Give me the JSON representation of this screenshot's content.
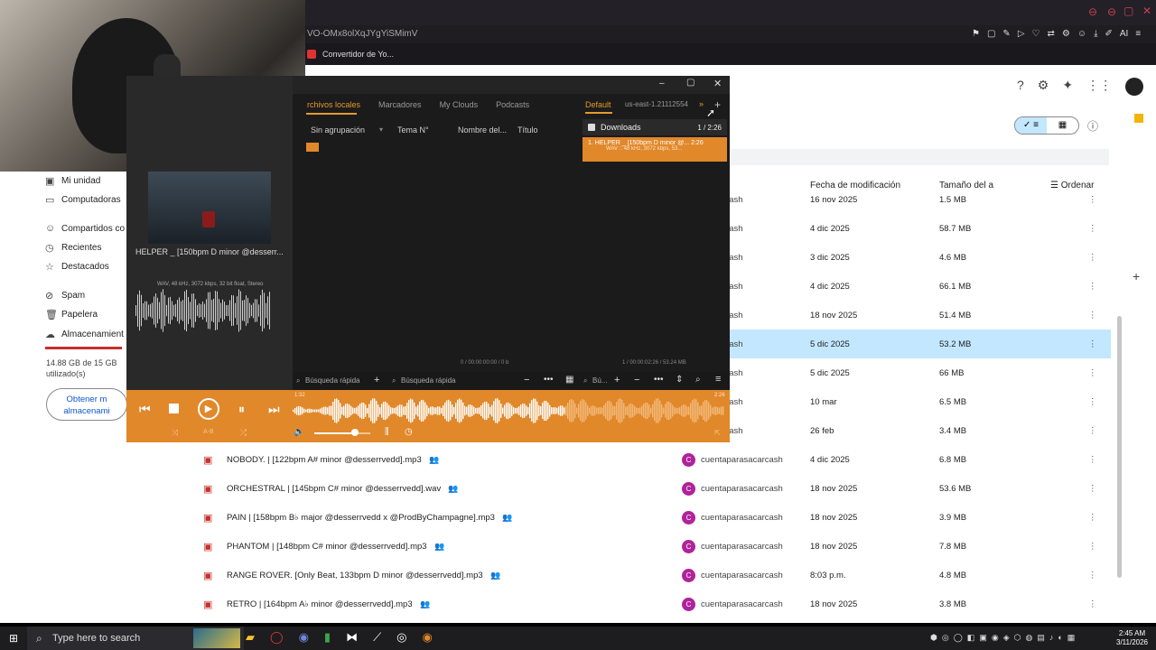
{
  "browser": {
    "address": "VO-OMx8olXqJYgYiSMimV",
    "bookmark": "Convertidor de Yo..."
  },
  "drive": {
    "sidebar": [
      {
        "label": "Mi unidad",
        "icon": "drive-icon"
      },
      {
        "label": "Computadoras",
        "icon": "computer-icon"
      },
      {
        "label": "Compartidos co",
        "icon": "people-icon"
      },
      {
        "label": "Recientes",
        "icon": "clock-icon"
      },
      {
        "label": "Destacados",
        "icon": "star-icon"
      },
      {
        "label": "Spam",
        "icon": "spam-icon"
      },
      {
        "label": "Papelera",
        "icon": "trash-icon"
      },
      {
        "label": "Almacenamient",
        "icon": "cloud-icon"
      }
    ],
    "storage_text": "14.88 GB de 15 GB utilizado(s)",
    "get_storage": "Obtener m almacenami",
    "columns": {
      "modified": "Fecha de modificación",
      "size": "Tamaño del a",
      "sort": "Ordenar"
    },
    "rows": [
      {
        "name": "",
        "owner": "aparasacarcash",
        "date": "16 nov 2025",
        "size": "1.5 MB",
        "selected": false
      },
      {
        "name": "",
        "owner": "aparasacarcash",
        "date": "4 dic 2025",
        "size": "58.7 MB",
        "selected": false
      },
      {
        "name": "",
        "owner": "aparasacarcash",
        "date": "3 dic 2025",
        "size": "4.6 MB",
        "selected": false
      },
      {
        "name": "",
        "owner": "aparasacarcash",
        "date": "4 dic 2025",
        "size": "66.1 MB",
        "selected": false
      },
      {
        "name": "",
        "owner": "aparasacarcash",
        "date": "18 nov 2025",
        "size": "51.4 MB",
        "selected": false
      },
      {
        "name": "",
        "owner": "aparasacarcash",
        "date": "5 dic 2025",
        "size": "53.2 MB",
        "selected": true
      },
      {
        "name": "",
        "owner": "aparasacarcash",
        "date": "5 dic 2025",
        "size": "66 MB",
        "selected": false
      },
      {
        "name": "",
        "owner": "aparasacarcash",
        "date": "10 mar",
        "size": "6.5 MB",
        "selected": false
      },
      {
        "name": "",
        "owner": "aparasacarcash",
        "date": "26 feb",
        "size": "3.4 MB",
        "selected": false
      },
      {
        "name": "NOBODY. | [122bpm A# minor @desserrvedd].mp3",
        "owner": "cuentaparasacarcash",
        "date": "4 dic 2025",
        "size": "6.8 MB",
        "selected": false
      },
      {
        "name": "ORCHESTRAL | [145bpm C# minor @desserrvedd].wav",
        "owner": "cuentaparasacarcash",
        "date": "18 nov 2025",
        "size": "53.6 MB",
        "selected": false
      },
      {
        "name": "PAIN | [158bpm B♭ major @desserrvedd x @ProdByChampagne].mp3",
        "owner": "cuentaparasacarcash",
        "date": "18 nov 2025",
        "size": "3.9 MB",
        "selected": false
      },
      {
        "name": "PHANTOM | [148bpm C# minor @desserrvedd].mp3",
        "owner": "cuentaparasacarcash",
        "date": "18 nov 2025",
        "size": "7.8 MB",
        "selected": false
      },
      {
        "name": "RANGE ROVER. [Only Beat, 133bpm D minor @desserrvedd].mp3",
        "owner": "cuentaparasacarcash",
        "date": "8:03 p.m.",
        "size": "4.8 MB",
        "selected": false
      },
      {
        "name": "RETRO | [164bpm A♭ minor @desserrvedd].mp3",
        "owner": "cuentaparasacarcash",
        "date": "18 nov 2025",
        "size": "3.8 MB",
        "selected": false
      }
    ]
  },
  "player": {
    "tabs": [
      "rchivos locales",
      "Marcadores",
      "My Clouds",
      "Podcasts"
    ],
    "playlist_tabs": [
      "Default",
      "us-east-1.21112554"
    ],
    "columns": [
      "Sin agrupación",
      "Tema N°",
      "Nombre del...",
      "Título"
    ],
    "downloads_label": "Downloads",
    "downloads_count": "1 / 2:26",
    "track_line": "1. HELPER _ [150bpm D minor @... 2:26",
    "track_info": "WAV :: 48 kHz, 3072 kbps, 53...",
    "now_playing": "HELPER _ [150bpm D minor @desserr...",
    "format_info": "WAV, 48 kHz, 3072 kbps, 32 bit float, Stereo",
    "status_left": "0 / 00:00:00:00 / 0 b",
    "status_right": "1 / 00:00:02:26 / 53.24 MB",
    "search1": "Búsqueda rápida",
    "search2": "Búsqueda rápida",
    "search3": "Bú...",
    "time_start": "1:32",
    "time_end": "2:26",
    "ab_label": "A-B",
    "volume": 0.72,
    "progress": 0.63
  },
  "taskbar": {
    "search_placeholder": "Type here to search",
    "time": "2:45 AM",
    "date": "3/11/2026"
  },
  "colors": {
    "accent": "#e1882b",
    "drive_selected": "#c2e7ff",
    "owner_avatar": "#b0239a"
  }
}
